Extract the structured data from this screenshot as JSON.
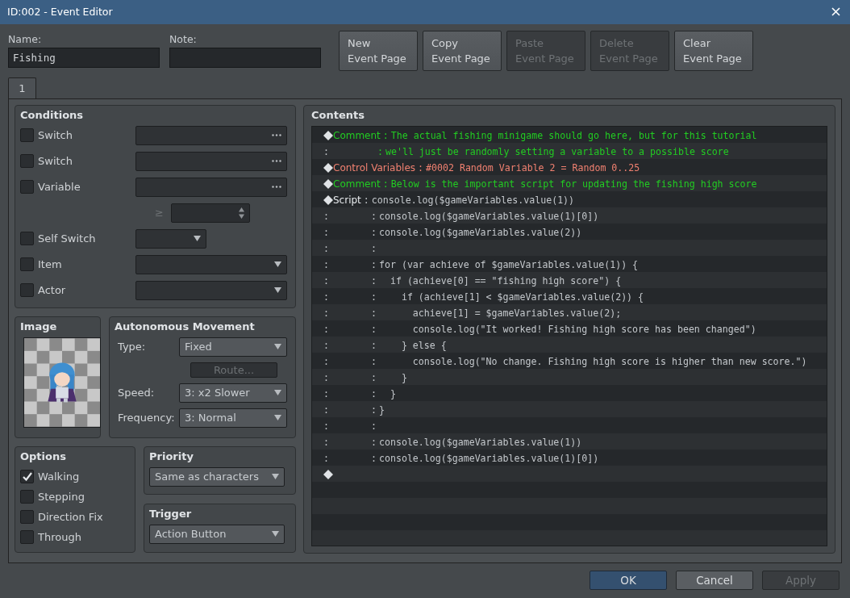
{
  "window": {
    "title": "ID:002 - Event Editor"
  },
  "name": {
    "label": "Name:",
    "value": "Fishing"
  },
  "note": {
    "label": "Note:"
  },
  "page_buttons": [
    {
      "label": "New\nEvent Page",
      "disabled": false
    },
    {
      "label": "Copy\nEvent Page",
      "disabled": false
    },
    {
      "label": "Paste\nEvent Page",
      "disabled": true
    },
    {
      "label": "Delete\nEvent Page",
      "disabled": true
    },
    {
      "label": "Clear\nEvent Page",
      "disabled": false
    }
  ],
  "tabs": [
    {
      "label": "1",
      "selected": true
    }
  ],
  "conditions": {
    "title": "Conditions",
    "rows": [
      {
        "kind": "picker",
        "label": "Switch",
        "checked": false
      },
      {
        "kind": "picker",
        "label": "Switch",
        "checked": false
      },
      {
        "kind": "picker",
        "label": "Variable",
        "checked": false
      },
      {
        "kind": "compare",
        "operator": "≥"
      },
      {
        "kind": "short-select",
        "label": "Self Switch",
        "checked": false
      },
      {
        "kind": "select",
        "label": "Item",
        "checked": false
      },
      {
        "kind": "select",
        "label": "Actor",
        "checked": false
      }
    ]
  },
  "image": {
    "title": "Image"
  },
  "movement": {
    "title": "Autonomous Movement",
    "type": {
      "label": "Type:",
      "value": "Fixed"
    },
    "route": {
      "label": "Route...",
      "disabled": true
    },
    "speed": {
      "label": "Speed:",
      "value": "3: x2 Slower"
    },
    "frequency": {
      "label": "Frequency:",
      "value": "3: Normal"
    }
  },
  "options": {
    "title": "Options",
    "items": [
      {
        "label": "Walking",
        "checked": true
      },
      {
        "label": "Stepping",
        "checked": false
      },
      {
        "label": "Direction Fix",
        "checked": false
      },
      {
        "label": "Through",
        "checked": false
      }
    ]
  },
  "priority": {
    "title": "Priority",
    "value": "Same as characters"
  },
  "trigger": {
    "title": "Trigger",
    "value": "Action Button"
  },
  "contents": {
    "title": "Contents",
    "rows": [
      {
        "kind": "command",
        "command": "Comment",
        "separator": ":",
        "text": "The actual fishing minigame should go here, but for this tutorial",
        "color": "#22cc22"
      },
      {
        "kind": "comment-continuation",
        "marker": ":",
        "separator": ":",
        "text": "we'll just be randomly setting a variable to a possible score",
        "color": "#22cc22"
      },
      {
        "kind": "command",
        "command": "Control Variables",
        "separator": ":",
        "text": "#0002 Random Variable 2 = Random 0..25",
        "color": "#f08070"
      },
      {
        "kind": "command",
        "command": "Comment",
        "separator": ":",
        "text": "Below is the important script for updating the fishing high score",
        "color": "#22cc22"
      },
      {
        "kind": "script",
        "command": "Script",
        "separator": ":",
        "text": "console.log($gameVariables.value(1))",
        "color": "#c4c8cc"
      },
      {
        "kind": "continuation",
        "marker": ":",
        "separator": ":",
        "text": "console.log($gameVariables.value(1)[0])",
        "color": "#c4c8cc"
      },
      {
        "kind": "continuation",
        "marker": ":",
        "separator": ":",
        "text": "console.log($gameVariables.value(2))",
        "color": "#c4c8cc"
      },
      {
        "kind": "continuation",
        "marker": ":",
        "separator": ":"
      },
      {
        "kind": "continuation",
        "marker": ":",
        "separator": ":",
        "text": "for (var achieve of $gameVariables.value(1)) {",
        "color": "#c4c8cc"
      },
      {
        "kind": "continuation",
        "marker": ":",
        "separator": ":",
        "text": "  if (achieve[0] == \"fishing high score\") {",
        "color": "#c4c8cc"
      },
      {
        "kind": "continuation",
        "marker": ":",
        "separator": ":",
        "text": "    if (achieve[1] < $gameVariables.value(2)) {",
        "color": "#c4c8cc"
      },
      {
        "kind": "continuation",
        "marker": ":",
        "separator": ":",
        "text": "      achieve[1] = $gameVariables.value(2);",
        "color": "#c4c8cc"
      },
      {
        "kind": "continuation",
        "marker": ":",
        "separator": ":",
        "text": "      console.log(\"It worked! Fishing high score has been changed\")",
        "color": "#c4c8cc"
      },
      {
        "kind": "continuation",
        "marker": ":",
        "separator": ":",
        "text": "    } else {",
        "color": "#c4c8cc"
      },
      {
        "kind": "continuation",
        "marker": ":",
        "separator": ":",
        "text": "      console.log(\"No change. Fishing high score is higher than new score.\")",
        "color": "#c4c8cc"
      },
      {
        "kind": "continuation",
        "marker": ":",
        "separator": ":",
        "text": "    }",
        "color": "#c4c8cc"
      },
      {
        "kind": "continuation",
        "marker": ":",
        "separator": ":",
        "text": "  }",
        "color": "#c4c8cc"
      },
      {
        "kind": "continuation",
        "marker": ":",
        "separator": ":",
        "text": "}",
        "color": "#c4c8cc"
      },
      {
        "kind": "continuation",
        "marker": ":",
        "separator": ":"
      },
      {
        "kind": "continuation",
        "marker": ":",
        "separator": ":",
        "text": "console.log($gameVariables.value(1))",
        "color": "#c4c8cc"
      },
      {
        "kind": "continuation",
        "marker": ":",
        "separator": ":",
        "text": "console.log($gameVariables.value(1)[0])",
        "color": "#c4c8cc"
      },
      {
        "kind": "end"
      }
    ]
  },
  "footer_buttons": [
    {
      "label": "OK",
      "kind": "primary",
      "disabled": false
    },
    {
      "label": "Cancel",
      "kind": "normal",
      "disabled": false
    },
    {
      "label": "Apply",
      "kind": "normal",
      "disabled": true
    }
  ]
}
